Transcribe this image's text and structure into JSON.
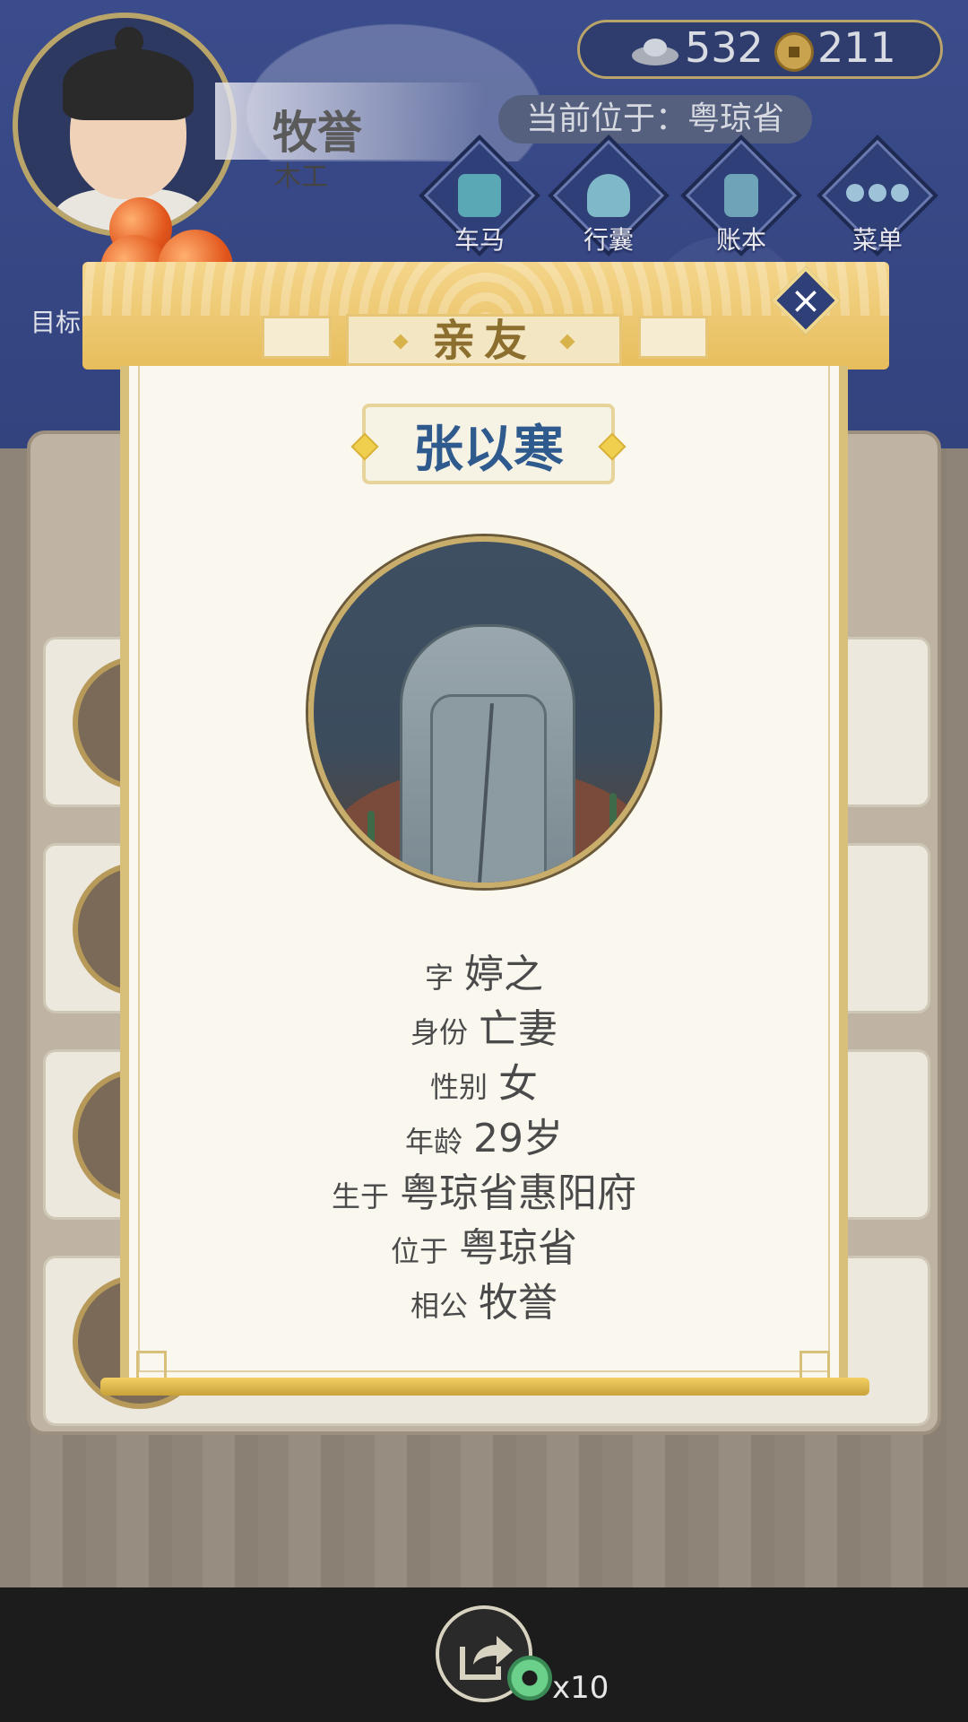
{
  "player": {
    "name": "牧誉",
    "job": "木工"
  },
  "currency": {
    "silver": "532",
    "copper": "211"
  },
  "location": "当前位于：粤琼省",
  "nav": [
    {
      "label": "车马",
      "icon": "carriage-icon"
    },
    {
      "label": "行囊",
      "icon": "bag-icon"
    },
    {
      "label": "账本",
      "icon": "ledger-icon"
    },
    {
      "label": "菜单",
      "icon": "menu-dots-icon"
    }
  ],
  "goal": {
    "label": "目标"
  },
  "modal": {
    "title": "亲友",
    "name": "张以寒",
    "fields": [
      {
        "k": "字",
        "v": "婷之"
      },
      {
        "k": "身份",
        "v": "亡妻"
      },
      {
        "k": "性别",
        "v": "女"
      },
      {
        "k": "年龄",
        "v": "29岁"
      },
      {
        "k": "生于",
        "v": "粤琼省惠阳府"
      },
      {
        "k": "位于",
        "v": "粤琼省"
      },
      {
        "k": "相公",
        "v": "牧誉"
      }
    ]
  },
  "bottom": {
    "reward_count": "x10"
  },
  "colors": {
    "accent_gold": "#d9c07a",
    "name_blue": "#2f5a8e",
    "bg_blue": "#2f3f78"
  }
}
